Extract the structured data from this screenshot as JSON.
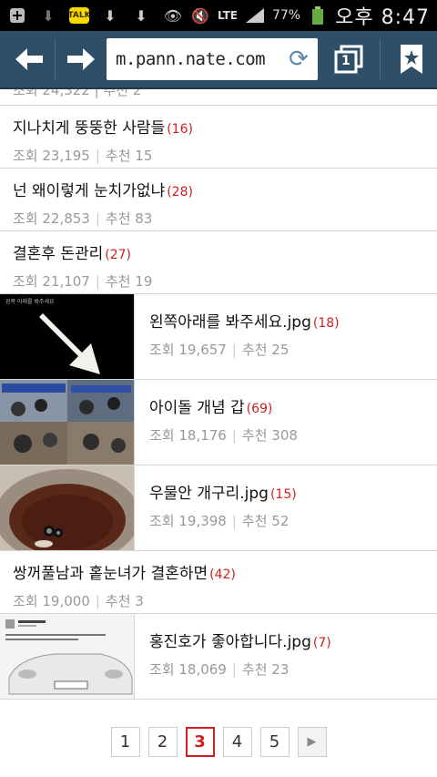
{
  "status": {
    "network": "LTE",
    "battery": "77%",
    "time": "오후 8:47"
  },
  "browser": {
    "url": "m.pann.nate.com",
    "tabs_count": "1"
  },
  "partial_row": {
    "meta": "조회 24,322 | 추천 2"
  },
  "items": [
    {
      "title": "지나치게 뚱뚱한 사람들",
      "count": "(16)",
      "views": "조회 23,195",
      "likes": "추천 15"
    },
    {
      "title": "넌 왜이렇게 눈치가없냐",
      "count": "(28)",
      "views": "조회 22,853",
      "likes": "추천 83"
    },
    {
      "title": "결혼후 돈관리",
      "count": "(27)",
      "views": "조회 21,107",
      "likes": "추천 19"
    },
    {
      "title": "왼쪽아래를 봐주세요.jpg",
      "count": "(18)",
      "views": "조회 19,657",
      "likes": "추천 25"
    },
    {
      "title": "아이돌 개념 갑",
      "count": "(69)",
      "views": "조회 18,176",
      "likes": "추천 308"
    },
    {
      "title": "우물안 개구리.jpg",
      "count": "(15)",
      "views": "조회 19,398",
      "likes": "추천 52"
    },
    {
      "title": "쌍꺼풀남과 홑눈녀가 결혼하면",
      "count": "(42)",
      "views": "조회 19,000",
      "likes": "추천 3"
    },
    {
      "title": "홍진호가 좋아합니다.jpg",
      "count": "(7)",
      "views": "조회 18,069",
      "likes": "추천 23"
    }
  ],
  "thumb_caption": "왼쪽 아래를 봐주세요",
  "pagination": {
    "pages": [
      "1",
      "2",
      "3",
      "4",
      "5"
    ],
    "current": "3",
    "next": "▶"
  }
}
